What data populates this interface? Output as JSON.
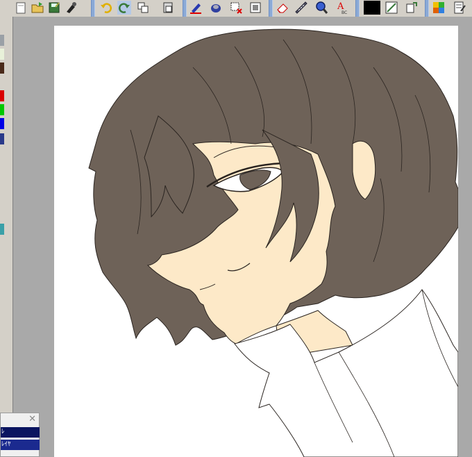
{
  "toolbar": {
    "groups": [
      {
        "name": "file",
        "icons": [
          "new-file-icon",
          "open-folder-icon",
          "save-icon",
          "brush-icon"
        ]
      },
      {
        "name": "edit",
        "icons": [
          "undo-icon",
          "redo-icon",
          "copy-icon",
          "paste-icon"
        ]
      },
      {
        "name": "draw",
        "icons": [
          "pen-icon",
          "fill-bucket-icon",
          "select-clear-icon",
          "canvas-icon"
        ]
      },
      {
        "name": "tools",
        "icons": [
          "eraser-icon",
          "ruler-icon",
          "zoom-icon",
          "text-icon"
        ]
      },
      {
        "name": "color",
        "icons": [
          "color-black-icon",
          "ruler-pen-icon",
          "layer-move-icon"
        ]
      },
      {
        "name": "view",
        "icons": [
          "palette-grid-icon",
          "notes-icon"
        ]
      }
    ],
    "current_color": "#000000"
  },
  "left_panel": {
    "swatches": [
      "#9aa0a6",
      "#e8f1d9",
      "#4a2a1a",
      "#d90000",
      "#00c800",
      "#0000e6",
      "#2a3a8a",
      "#3aa0a8"
    ]
  },
  "layer_window": {
    "rows": [
      "ﾚ",
      "ﾚｲﾔ"
    ]
  },
  "colors": {
    "hair": "#6e6258",
    "skin": "#fde9c8",
    "line": "#2a2420",
    "shirt": "#ffffff"
  }
}
